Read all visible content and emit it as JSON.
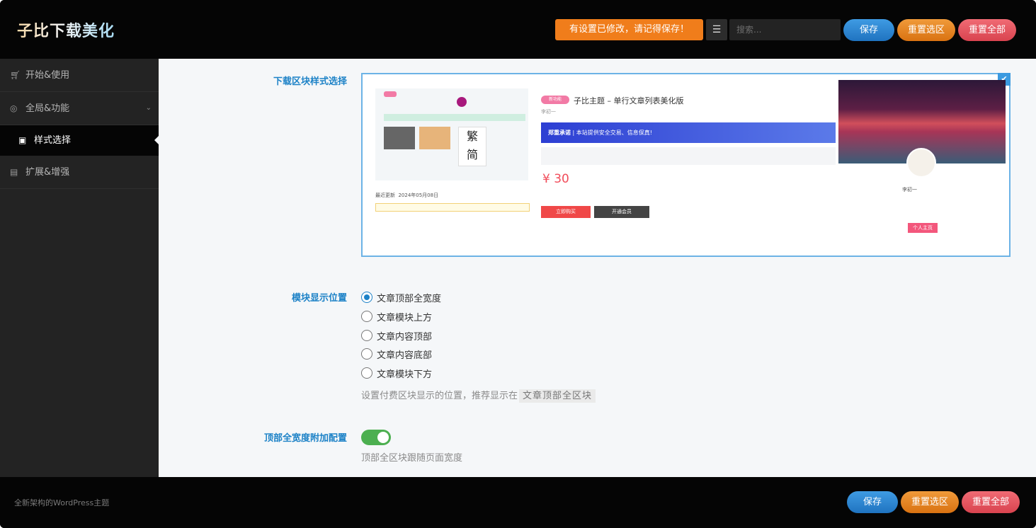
{
  "app": {
    "logo": "子比下载美化"
  },
  "header": {
    "notice": "有设置已修改，请记得保存！",
    "search_placeholder": "搜索...",
    "save": "保存",
    "reset_section": "重置选区",
    "reset_all": "重置全部"
  },
  "sidebar": {
    "items": [
      {
        "label": "开始&使用",
        "icon": "cart-icon"
      },
      {
        "label": "全局&功能",
        "icon": "settings-icon"
      },
      {
        "label": "扩展&增强",
        "icon": "calendar-check-icon"
      }
    ],
    "sub_item": {
      "label": "样式选择",
      "icon": "image-icon"
    }
  },
  "fields": {
    "style_label": "下载区块样式选择",
    "position_label": "模块显示位置",
    "position_options": [
      "文章顶部全宽度",
      "文章模块上方",
      "文章内容顶部",
      "文章内容底部",
      "文章模块下方"
    ],
    "position_selected_index": 0,
    "position_help": "设置付费区块显示的位置，推荐显示在",
    "position_help_code": "文章顶部全区块",
    "fullwidth_label": "顶部全宽度附加配置",
    "fullwidth_enabled": true,
    "fullwidth_help": "顶部全区块跟随页面宽度"
  },
  "preview": {
    "title": "子比主题 – 单行文章列表美化版",
    "badge": "新功能",
    "promise": "郑重承诺",
    "promise_text": "本站提供安全交易、信息保真!",
    "price": "¥ 30",
    "author": "李初一",
    "buy": "立即购买",
    "vip": "开通会员",
    "update_label": "最近更新",
    "update_date": "2024年05月08日",
    "profile_button": "个人主页",
    "big_char_top": "繁",
    "big_char_bottom": "简"
  },
  "footer": {
    "text": "全新架构的WordPress主题",
    "save": "保存",
    "reset_section": "重置选区",
    "reset_all": "重置全部"
  },
  "colors": {
    "accent_blue": "#1d82c7",
    "notice_orange": "#f07d1b",
    "toggle_green": "#4caf50"
  }
}
